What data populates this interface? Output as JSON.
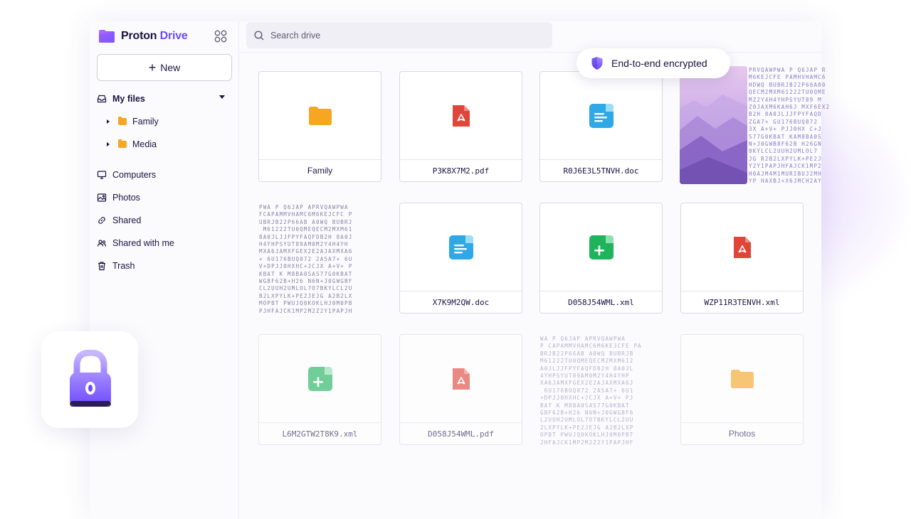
{
  "brand": {
    "name_part1": "Proton",
    "name_part2": "Drive"
  },
  "sidebar": {
    "new_label": "New",
    "my_files": "My files",
    "tree": [
      {
        "label": "Family"
      },
      {
        "label": "Media"
      }
    ],
    "items": [
      {
        "label": "Computers",
        "icon": "monitor-icon"
      },
      {
        "label": "Photos",
        "icon": "image-icon"
      },
      {
        "label": "Shared",
        "icon": "link-icon"
      },
      {
        "label": "Shared with me",
        "icon": "users-icon"
      },
      {
        "label": "Trash",
        "icon": "trash-icon"
      }
    ]
  },
  "search": {
    "placeholder": "Search drive"
  },
  "badge": {
    "label": "End-to-end encrypted"
  },
  "files": [
    {
      "name": "Family",
      "type": "folder"
    },
    {
      "name": "P3K8X7M2.pdf",
      "type": "pdf"
    },
    {
      "name": "R0J6E3L5TNVH.doc",
      "type": "doc"
    },
    {
      "name": "X7K9M2QW.doc",
      "type": "doc"
    },
    {
      "name": "D058J54WML.xml",
      "type": "sheet"
    },
    {
      "name": "WZP11R3TENVH.xml",
      "type": "pdf"
    },
    {
      "name": "L6M2GTW2T8K9.xml",
      "type": "sheet"
    },
    {
      "name": "D058J54WML.pdf",
      "type": "pdf"
    },
    {
      "name": "Photos",
      "type": "folder"
    }
  ],
  "colors": {
    "accent": "#6d4aff",
    "folder": "#f5a623",
    "pdf": "#e0453a",
    "doc": "#2ea8e6",
    "sheet": "#1fb35b"
  }
}
